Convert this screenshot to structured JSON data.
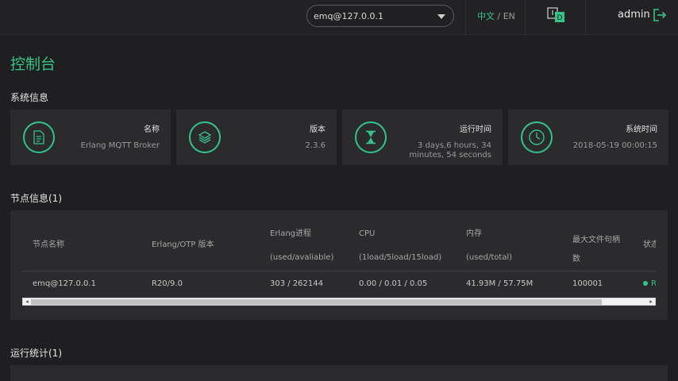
{
  "header": {
    "node_select_value": "emq@127.0.0.1",
    "lang_zh": "中文",
    "lang_sep": " / ",
    "lang_en": "EN",
    "notify_badge": "D",
    "username": "admin"
  },
  "page": {
    "title": "控制台"
  },
  "system_info": {
    "section_title": "系统信息",
    "cards": [
      {
        "icon": "document-icon",
        "label": "名称",
        "value": "Erlang MQTT Broker"
      },
      {
        "icon": "layers-icon",
        "label": "版本",
        "value": "2.3.6"
      },
      {
        "icon": "hourglass-icon",
        "label": "运行时间",
        "value": "3 days,6 hours, 34 minutes, 54 seconds"
      },
      {
        "icon": "clock-icon",
        "label": "系统时间",
        "value": "2018-05-19 00:00:15"
      }
    ]
  },
  "node_info": {
    "section_title": "节点信息(1)",
    "columns": [
      {
        "label": "节点名称",
        "sub": ""
      },
      {
        "label": "Erlang/OTP 版本",
        "sub": ""
      },
      {
        "label": "Erlang进程",
        "sub": "(used/avaliable)"
      },
      {
        "label": "CPU",
        "sub": "(1load/5load/15load)"
      },
      {
        "label": "内存",
        "sub": "(used/total)"
      },
      {
        "label": "最大文件句柄数",
        "sub": ""
      },
      {
        "label": "状态",
        "sub": ""
      }
    ],
    "rows": [
      {
        "node_name": "emq@127.0.0.1",
        "otp_version": "R20/9.0",
        "processes": "303 / 262144",
        "cpu": "0.00 / 0.01 / 0.05",
        "memory": "41.93M / 57.75M",
        "max_fds": "100001",
        "status": "R"
      }
    ]
  },
  "stats": {
    "section_title": "运行统计(1)"
  },
  "colors": {
    "accent": "#34c388",
    "background": "#1f1f21",
    "panel": "#2b2b2e"
  }
}
